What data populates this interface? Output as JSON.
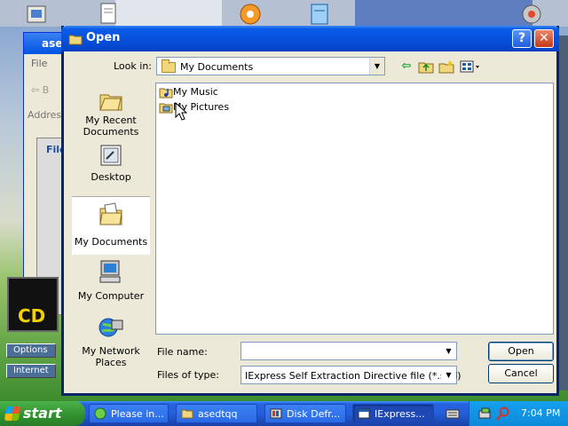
{
  "background_window": {
    "title": "ased",
    "menu_file": "File",
    "back_label": "B",
    "address_label": "Addres",
    "inner_title": "File"
  },
  "side_buttons": [
    "Options",
    "Internet"
  ],
  "cd_logo_text": "CD",
  "dialog": {
    "title": "Open",
    "help_label": "?",
    "close_label": "✕",
    "look_in_label": "Look in:",
    "look_in_value": "My Documents",
    "places": [
      {
        "label": "My Recent Documents"
      },
      {
        "label": "Desktop"
      },
      {
        "label": "My Documents",
        "selected": true
      },
      {
        "label": "My Computer"
      },
      {
        "label": "My Network Places"
      }
    ],
    "files": [
      {
        "name": "My Music",
        "icon": "music-folder-icon"
      },
      {
        "name": "My Pictures",
        "icon": "pictures-folder-icon"
      }
    ],
    "file_name_label": "File name:",
    "file_name_value": "",
    "files_of_type_label": "Files of type:",
    "files_of_type_value": "IExpress Self Extraction Directive file (*.sed)",
    "open_button": "Open",
    "cancel_button": "Cancel"
  },
  "taskbar": {
    "start_label": "start",
    "tasks": [
      {
        "label": "Please in...",
        "active": false
      },
      {
        "label": "asedtqq",
        "active": false
      },
      {
        "label": "Disk Defr...",
        "active": false
      },
      {
        "label": "IExpress...",
        "active": true
      }
    ],
    "clock": "7:04 PM"
  },
  "colors": {
    "title_bar": "#0650dc",
    "dialog_bg": "#ece9d8",
    "taskbar": "#245edb",
    "start_green": "#2f8f2d",
    "tray": "#0d8ad9"
  }
}
